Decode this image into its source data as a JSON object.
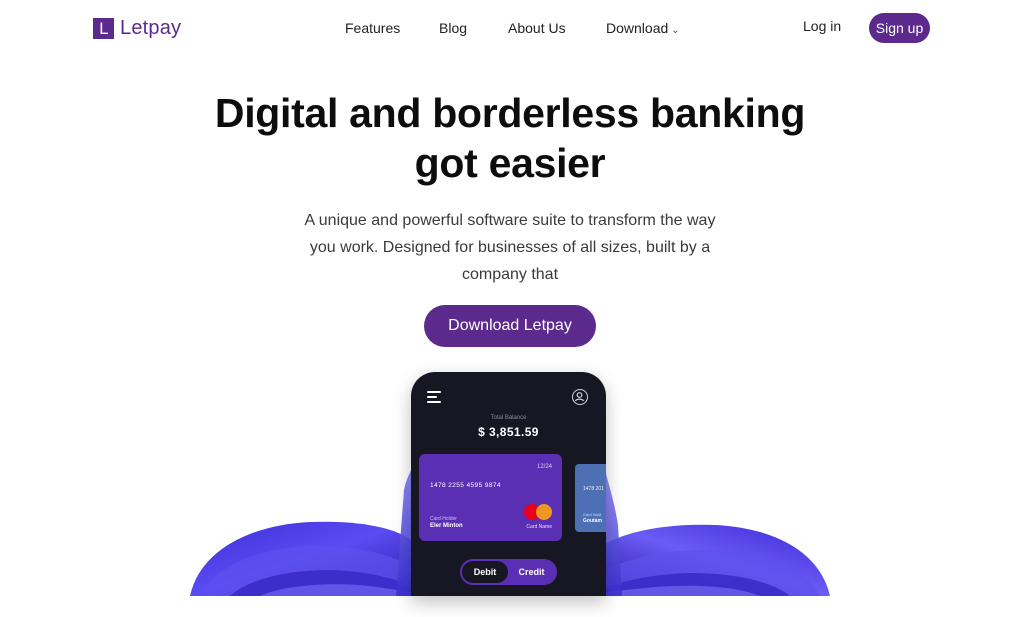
{
  "brand": {
    "logo_letter": "L",
    "name": "Letpay",
    "accent": "#5b2a8c"
  },
  "nav": {
    "links": [
      "Features",
      "Blog",
      "About Us",
      "Download"
    ],
    "download_chevron": "⌄",
    "login_label": "Log in",
    "signup_label": "Sign up"
  },
  "hero": {
    "headline_line1": "Digital and borderless banking",
    "headline_line2": "got easier",
    "subtitle": "A unique and powerful software suite to transform the way you work. Designed for businesses of all sizes, built by a company that",
    "cta_label": "Download Letpay"
  },
  "phone": {
    "menu_icon": "hamburger-menu-icon",
    "profile_icon": "user-profile-icon",
    "balance_label": "Total Balance",
    "balance_value": "$ 3,851.59",
    "card": {
      "expiry": "12/24",
      "number": "1478 2255 4595 9874",
      "holder_label": "Card Holder",
      "holder_name": "Eler Minton",
      "brand_label": "Card Name",
      "brand_icon": "mastercard-logo"
    },
    "card_secondary": {
      "number": "1478 201",
      "holder_label": "Card Hold",
      "holder_name": "Goutam"
    },
    "toggle": {
      "debit": "Debit",
      "credit": "Credit",
      "active": "Debit"
    }
  }
}
